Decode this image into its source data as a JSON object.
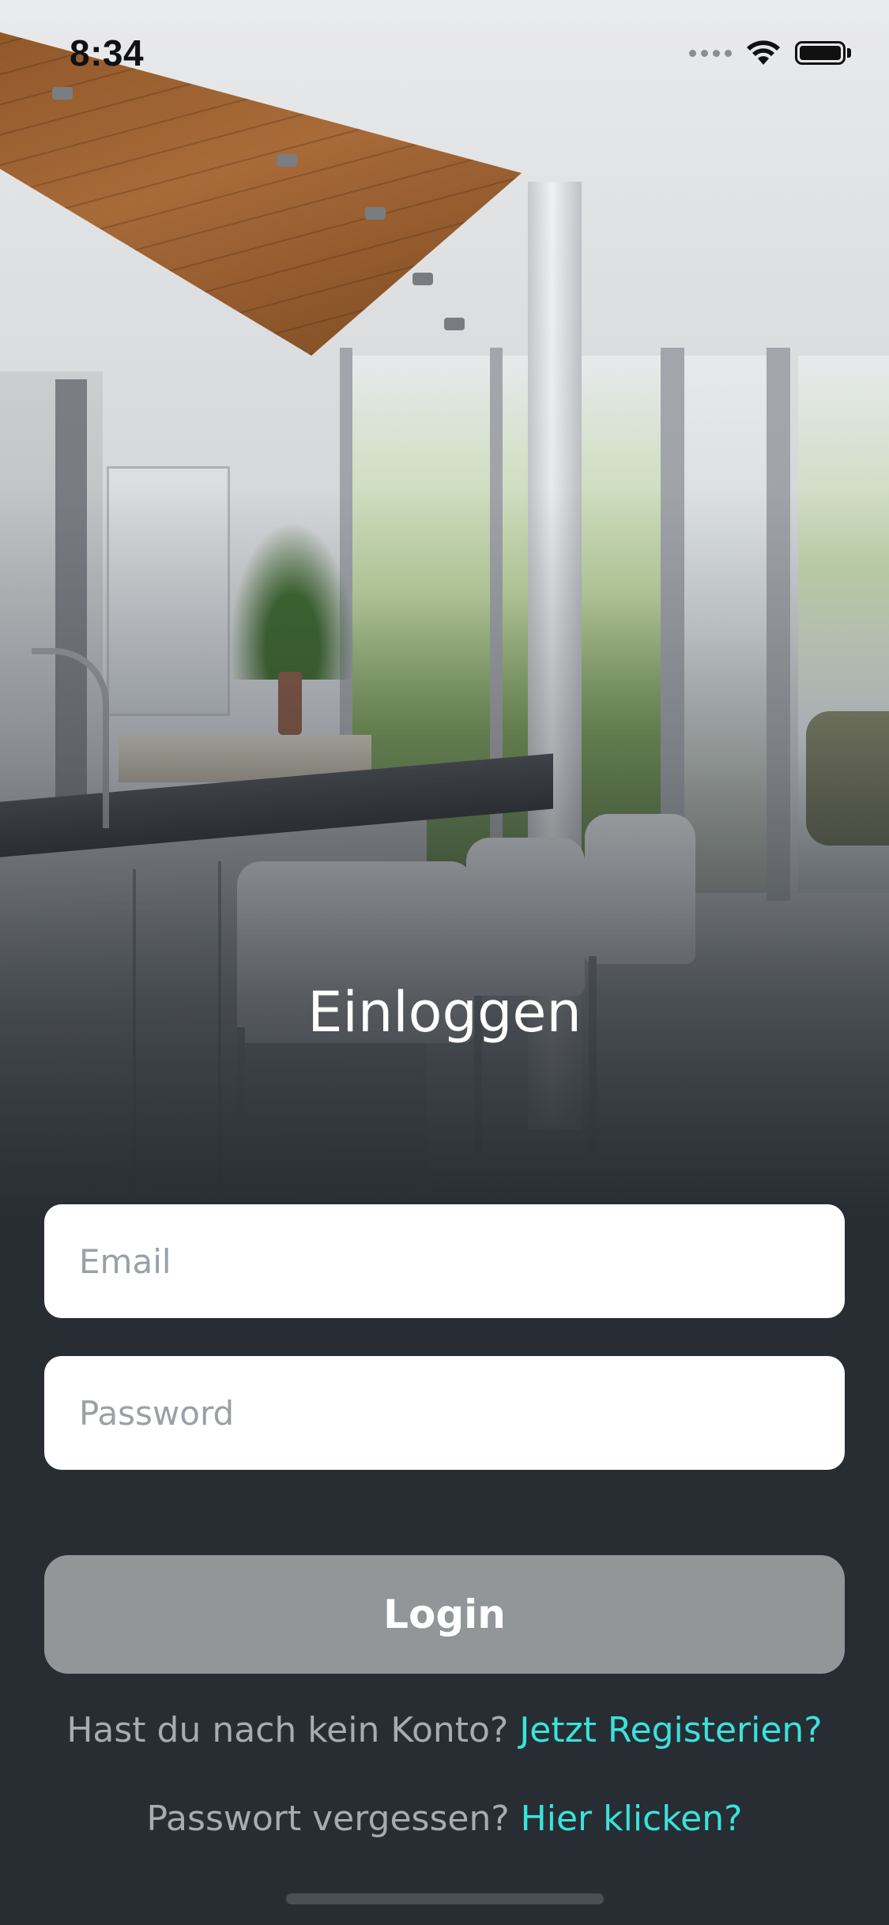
{
  "status_bar": {
    "time": "8:34",
    "icons": [
      "signal-icon",
      "wifi-icon",
      "battery-icon"
    ]
  },
  "background": {
    "description_icon": "interior-photo"
  },
  "login": {
    "title": "Einloggen",
    "email_placeholder": "Email",
    "email_value": "",
    "password_placeholder": "Password",
    "password_value": "",
    "button_label": "Login"
  },
  "footer": {
    "register_prompt": "Hast du nach kein Konto?",
    "register_link": "Jetzt Registerien?",
    "forgot_prompt": "Passwort vergessen?",
    "forgot_link": "Hier klicken?"
  },
  "colors": {
    "background": "#282d33",
    "link": "#39e3dc",
    "button": "#939699",
    "field": "#ffffff"
  }
}
